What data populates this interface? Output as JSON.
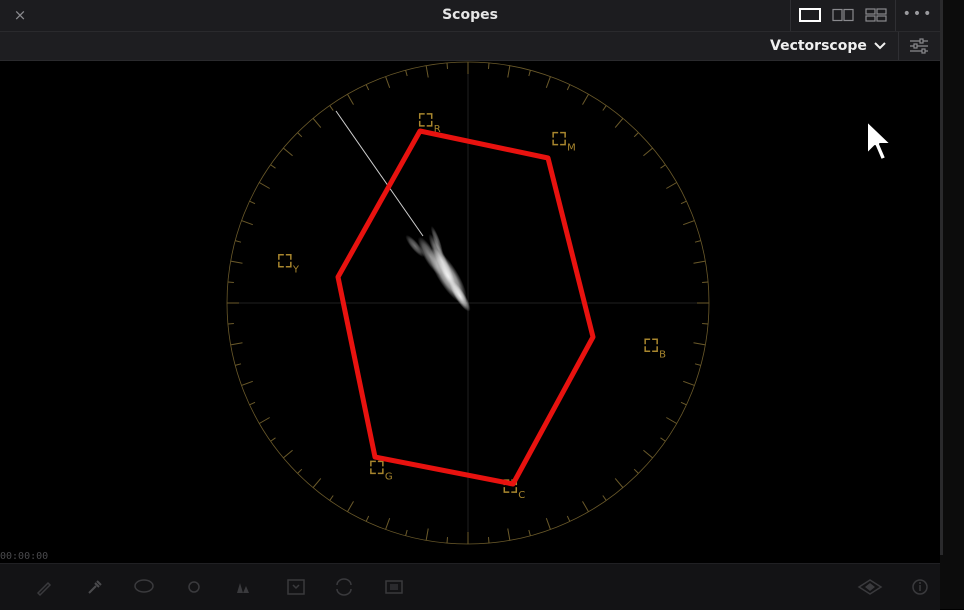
{
  "window": {
    "title": "Scopes",
    "close_glyph": "×",
    "more_glyph": "•••",
    "layout_options": [
      "single-view-icon",
      "dual-view-icon",
      "quad-view-icon"
    ]
  },
  "toolbar": {
    "scope_selected": "Vectorscope",
    "chevron": "⌄",
    "settings_icon": "sliders-icon"
  },
  "vectorscope": {
    "targets": [
      {
        "label": "R",
        "angle_deg": 103
      },
      {
        "label": "M",
        "angle_deg": 61
      },
      {
        "label": "B",
        "angle_deg": 347
      },
      {
        "label": "C",
        "angle_deg": 283
      },
      {
        "label": "G",
        "angle_deg": 241
      },
      {
        "label": "Y",
        "angle_deg": 167
      }
    ],
    "graticule_color": "#6b5a2a",
    "target_color": "#a8862e",
    "annotation_color": "#e8120f",
    "annotation": "red hexagon connecting the six color targets"
  },
  "status": {
    "timecode": "00:00:00"
  },
  "bottom_tools": [
    "pen-icon",
    "eyedropper-icon",
    "lasso-icon",
    "circle-icon",
    "color-icon",
    "save-icon",
    "refresh-icon",
    "frame-icon",
    "eye-icon",
    "info-icon"
  ],
  "colors": {
    "title_bg": "#1c1c1f",
    "toolbar_bg": "#1e1e21",
    "scope_bg": "#000000",
    "red_outline": "#e8120f"
  }
}
